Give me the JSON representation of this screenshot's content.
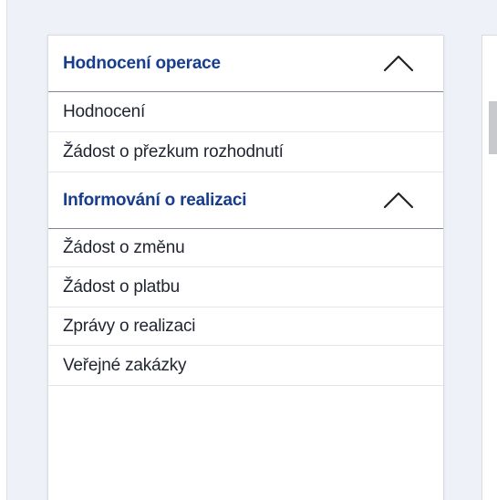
{
  "sidebar": {
    "sections": [
      {
        "title": "Hodnocení operace",
        "items": [
          {
            "label": "Hodnocení"
          },
          {
            "label": "Žádost o přezkum rozhodnutí"
          }
        ]
      },
      {
        "title": "Informování o realizaci",
        "items": [
          {
            "label": "Žádost o změnu"
          },
          {
            "label": "Žádost o platbu"
          },
          {
            "label": "Zprávy o realizaci"
          },
          {
            "label": "Veřejné zakázky"
          }
        ]
      }
    ],
    "icons": {
      "section_toggle": "chevron-up-icon"
    }
  },
  "colors": {
    "section_title": "#173d8c",
    "item_text": "#1f2430",
    "background": "#eef1f7"
  }
}
